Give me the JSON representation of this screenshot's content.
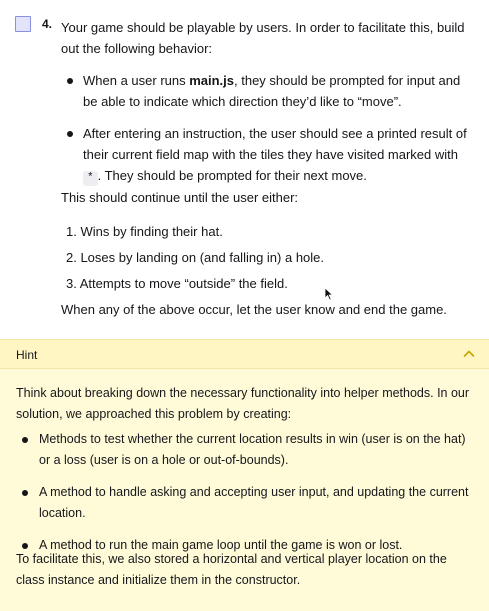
{
  "task": {
    "number": "4.",
    "intro": "Your game should be playable by users. In order to facilitate this, build out the following behavior:",
    "bullet1_before": "When a user runs ",
    "bullet1_code": "main.js",
    "bullet1_after": ", they should be prompted for input and be able to indicate which direction they’d like to “move”.",
    "bullet2_before": "After entering an instruction, the user should see a printed result of their current field map with the tiles they have visited marked with ",
    "bullet2_glyph": "*",
    "bullet2_after": ". They should be prompted for their next move.",
    "continue_text": "This should continue until the user either:",
    "conditions": [
      "1.  Wins by finding their hat.",
      "2.  Loses by landing on (and falling in) a hole.",
      "3.  Attempts to move “outside” the field."
    ],
    "closing": "When any of the above occur, let the user know and end the game."
  },
  "hint": {
    "title": "Hint",
    "intro": "Think about breaking down the necessary functionality into helper methods. In our solution, we approached this problem by creating:",
    "bullets": [
      "Methods to test whether the current location results in win (user is on the hat) or a loss (user is on a hole or out-of-bounds).",
      "A method to handle asking and accepting user input, and updating the current location.",
      "A method to run the main game loop until the game is won or lost."
    ],
    "closing": "To facilitate this, we also stored a horizontal and vertical player location on the class instance and initialize them in the constructor."
  },
  "colors": {
    "checkbox_border": "#8a8fe0",
    "checkbox_fill": "#e2e4fb",
    "hint_header_bg": "#fff6c4",
    "hint_body_bg": "#fffbd9",
    "chevron": "#c8a400"
  },
  "icons": {
    "hint_toggle": "chevron-up-icon",
    "pointer": "mouse-pointer-icon"
  }
}
